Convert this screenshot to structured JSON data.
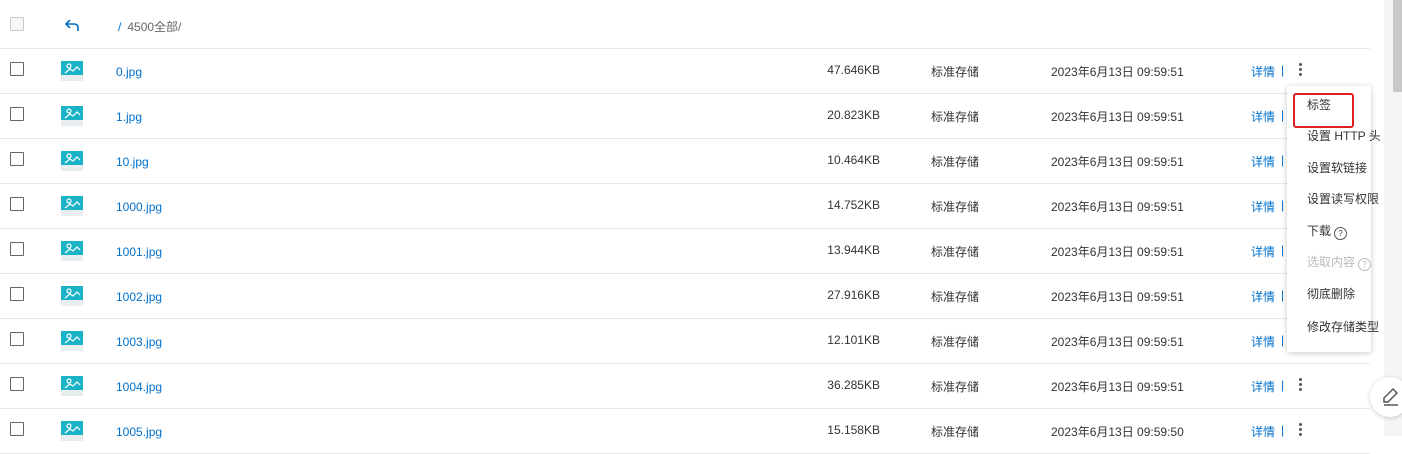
{
  "header": {
    "path_prefix": "/",
    "path": "4500全部/"
  },
  "colors": {
    "link": "#0070cc",
    "thumb": "#1ab3c6",
    "highlight": "#e02020"
  },
  "files": [
    {
      "name": "0.jpg",
      "size": "47.646KB",
      "storage": "标准存储",
      "date": "2023年6月13日 09:59:51",
      "detail": "详情",
      "sep": "|"
    },
    {
      "name": "1.jpg",
      "size": "20.823KB",
      "storage": "标准存储",
      "date": "2023年6月13日 09:59:51",
      "detail": "详情",
      "sep": "|"
    },
    {
      "name": "10.jpg",
      "size": "10.464KB",
      "storage": "标准存储",
      "date": "2023年6月13日 09:59:51",
      "detail": "详情",
      "sep": "|"
    },
    {
      "name": "1000.jpg",
      "size": "14.752KB",
      "storage": "标准存储",
      "date": "2023年6月13日 09:59:51",
      "detail": "详情",
      "sep": "|"
    },
    {
      "name": "1001.jpg",
      "size": "13.944KB",
      "storage": "标准存储",
      "date": "2023年6月13日 09:59:51",
      "detail": "详情",
      "sep": "|"
    },
    {
      "name": "1002.jpg",
      "size": "27.916KB",
      "storage": "标准存储",
      "date": "2023年6月13日 09:59:51",
      "detail": "详情",
      "sep": "|"
    },
    {
      "name": "1003.jpg",
      "size": "12.101KB",
      "storage": "标准存储",
      "date": "2023年6月13日 09:59:51",
      "detail": "详情",
      "sep": "|"
    },
    {
      "name": "1004.jpg",
      "size": "36.285KB",
      "storage": "标准存储",
      "date": "2023年6月13日 09:59:51",
      "detail": "详情",
      "sep": "|"
    },
    {
      "name": "1005.jpg",
      "size": "15.158KB",
      "storage": "标准存储",
      "date": "2023年6月13日 09:59:50",
      "detail": "详情",
      "sep": "|"
    }
  ],
  "context_menu": {
    "items": [
      {
        "label": "标签",
        "disabled": false,
        "help": false
      },
      {
        "label": "设置 HTTP 头",
        "disabled": false,
        "help": false
      },
      {
        "label": "设置软链接",
        "disabled": false,
        "help": false
      },
      {
        "label": "设置读写权限",
        "disabled": false,
        "help": false
      },
      {
        "label": "下载",
        "disabled": false,
        "help": true
      },
      {
        "label": "选取内容",
        "disabled": true,
        "help": true
      },
      {
        "label": "彻底删除",
        "disabled": false,
        "help": false
      },
      {
        "label": "修改存储类型",
        "disabled": false,
        "help": false
      }
    ],
    "help_glyph": "?"
  },
  "icons": [
    "checkbox-icon",
    "back-arrow-icon",
    "image-file-icon",
    "more-vertical-icon",
    "help-circle-icon",
    "edit-pencil-icon"
  ]
}
